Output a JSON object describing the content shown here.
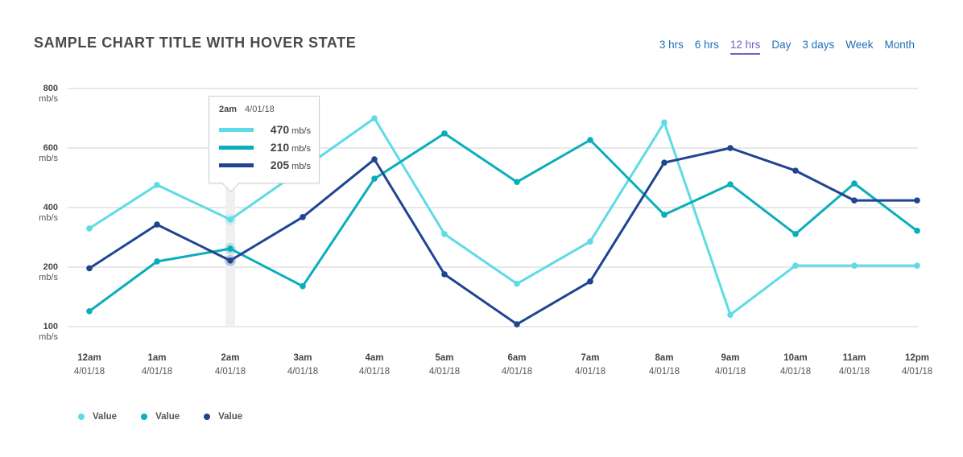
{
  "header": {
    "title": "SAMPLE CHART TITLE WITH HOVER STATE"
  },
  "range_selector": {
    "options": [
      "3 hrs",
      "6 hrs",
      "12 hrs",
      "Day",
      "3 days",
      "Week",
      "Month"
    ],
    "selected": "12 hrs"
  },
  "tooltip": {
    "time": "2am",
    "date": "4/01/18",
    "rows": [
      {
        "value": "470",
        "unit": "mb/s",
        "color": "#5ddbe6"
      },
      {
        "value": "210",
        "unit": "mb/s",
        "color": "#0aaebb"
      },
      {
        "value": "205",
        "unit": "mb/s",
        "color": "#1f4592"
      }
    ]
  },
  "legend": [
    {
      "label": "Value",
      "color": "#5ddbe6"
    },
    {
      "label": "Value",
      "color": "#0aaebb"
    },
    {
      "label": "Value",
      "color": "#1f4592"
    }
  ],
  "chart_data": {
    "type": "line",
    "title": "SAMPLE CHART TITLE WITH HOVER STATE",
    "xlabel": "",
    "ylabel": "mb/s",
    "y_ticks": [
      {
        "value": 800,
        "label": "800",
        "unit": "mb/s"
      },
      {
        "value": 600,
        "label": "600",
        "unit": "mb/s"
      },
      {
        "value": 400,
        "label": "400",
        "unit": "mb/s"
      },
      {
        "value": 200,
        "label": "200",
        "unit": "mb/s"
      },
      {
        "value": 100,
        "label": "100",
        "unit": "mb/s"
      }
    ],
    "ylim": [
      100,
      800
    ],
    "grid": true,
    "legend_position": "bottom-left",
    "hover_index": 2,
    "categories": [
      {
        "time": "12am",
        "date": "4/01/18"
      },
      {
        "time": "1am",
        "date": "4/01/18"
      },
      {
        "time": "2am",
        "date": "4/01/18"
      },
      {
        "time": "3am",
        "date": "4/01/18"
      },
      {
        "time": "4am",
        "date": "4/01/18"
      },
      {
        "time": "5am",
        "date": "4/01/18"
      },
      {
        "time": "6am",
        "date": "4/01/18"
      },
      {
        "time": "7am",
        "date": "4/01/18"
      },
      {
        "time": "8am",
        "date": "4/01/18"
      },
      {
        "time": "9am",
        "date": "4/01/18"
      },
      {
        "time": "10am",
        "date": "4/01/18"
      },
      {
        "time": "11am",
        "date": "4/01/18"
      },
      {
        "time": "12pm",
        "date": "4/01/18"
      }
    ],
    "series": [
      {
        "name": "Value",
        "color": "#5ddbe6",
        "values": [
          330,
          476,
          360,
          530,
          700,
          311,
          172,
          286,
          686,
          120,
          205,
          205,
          205
        ]
      },
      {
        "name": "Value",
        "color": "#0aaebb",
        "values": [
          126,
          219,
          262,
          168,
          497,
          649,
          486,
          627,
          376,
          478,
          311,
          481,
          322
        ]
      },
      {
        "name": "Value",
        "color": "#1f4592",
        "values": [
          198,
          343,
          222,
          368,
          562,
          188,
          104,
          176,
          551,
          600,
          524,
          424,
          424
        ]
      }
    ]
  }
}
